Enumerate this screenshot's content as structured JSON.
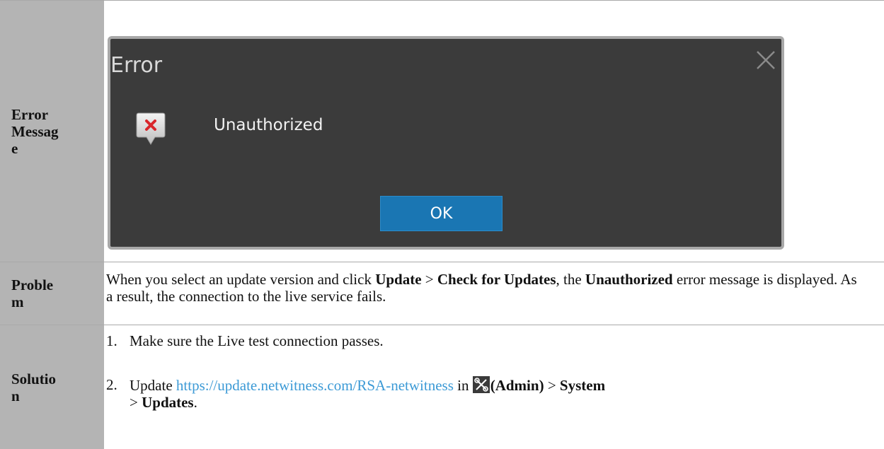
{
  "rows": {
    "error_message": {
      "label": "Error Message",
      "dialog": {
        "title": "Error",
        "message": "Unauthorized",
        "ok_label": "OK",
        "icon": "error-balloon-icon",
        "close_icon": "close-icon"
      }
    },
    "problem": {
      "label": "Problem",
      "text_1": "When you select an update version and click ",
      "bold_update": "Update",
      "sep": " > ",
      "bold_check": "Check for Updates",
      "text_2": ", the ",
      "bold_unauthorized": "Unauthorized",
      "text_3": " error message is displayed. As a result, the connection to the live service fails."
    },
    "solution": {
      "label": "Solution",
      "step1_num": "1.",
      "step1_text": "Make sure the Live test connection passes.",
      "step2_num": "2.",
      "step2_text_1": "Update ",
      "step2_link": "https://update.netwitness.com/RSA-netwitness",
      "step2_text_2": " in ",
      "step2_admin_icon": "admin-tools-icon",
      "step2_bold_admin": "(Admin)",
      "step2_sep_1": " > ",
      "step2_bold_system": "System",
      "step2_sep_2": " > ",
      "step2_bold_updates": "Updates",
      "step2_end": "."
    }
  },
  "colors": {
    "label_bg": "#b4b4b4",
    "dialog_bg": "#3b3b3b",
    "ok_bg": "#1a76b3",
    "link": "#3c9ad6",
    "error_red": "#d9262b"
  }
}
